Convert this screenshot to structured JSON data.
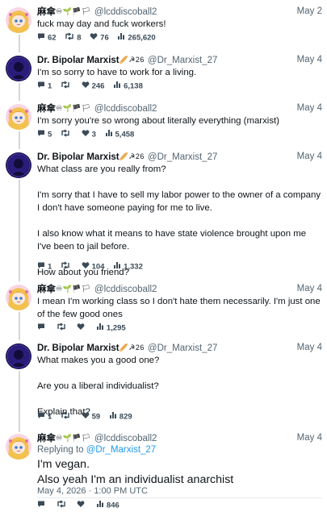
{
  "tweets": [
    {
      "name": "麻傘",
      "name_emoji": "♾🌱🏴🏳",
      "handle": "@lcddiscoball2",
      "date": "May 2",
      "text": [
        "fuck may day and fuck workers!"
      ],
      "replies": "62",
      "retweets": "8",
      "likes": "76",
      "views": "265,620"
    },
    {
      "name": "Dr. Bipolar Marxist",
      "name_emoji": "🥖☭26",
      "handle": "@Dr_Marxist_27",
      "date": "May 4",
      "text": [
        "I'm so sorry to have to work for a living."
      ],
      "replies": "1",
      "retweets": "",
      "likes": "246",
      "views": "6,138"
    },
    {
      "name": "麻傘",
      "name_emoji": "♾🌱🏴🏳",
      "handle": "@lcddiscoball2",
      "date": "May 4",
      "text": [
        "I'm sorry you're so wrong about literally everything (marxist)"
      ],
      "replies": "5",
      "retweets": "",
      "likes": "3",
      "views": "5,458"
    },
    {
      "name": "Dr. Bipolar Marxist",
      "name_emoji": "🥖☭26",
      "handle": "@Dr_Marxist_27",
      "date": "May 4",
      "text": [
        "What class are you really from?",
        "I'm sorry that I have to sell my labor power to the owner of a company I don't have someone paying for me to live.",
        "I also know what it means to have state violence brought upon me I've been to jail before.",
        "How about you friend?"
      ],
      "replies": "1",
      "retweets": "",
      "likes": "104",
      "views": "1,332"
    },
    {
      "name": "麻傘",
      "name_emoji": "♾🌱🏴🏳",
      "handle": "@lcddiscoball2",
      "date": "May 4",
      "text": [
        "I mean I'm working class so I don't hate them necessarily. I'm just one of the few good ones"
      ],
      "replies": "",
      "retweets": "",
      "likes": "",
      "views": "1,295"
    },
    {
      "name": "Dr. Bipolar Marxist",
      "name_emoji": "🥖☭26",
      "handle": "@Dr_Marxist_27",
      "date": "May 4",
      "text": [
        "What makes you a good one?",
        "Are you a liberal individualist?",
        "Explain that?"
      ],
      "replies": "1",
      "retweets": "",
      "likes": "59",
      "views": "829"
    }
  ],
  "main_tweet": {
    "name": "麻傘",
    "name_emoji": "♾🌱🏴🏳",
    "handle": "@lcddiscoball2",
    "date": "May 4",
    "replying_prefix": "Replying to",
    "replying_to": "@Dr_Marxist_27",
    "lines": [
      "I'm vegan.",
      "Also yeah I'm an individualist anarchist"
    ],
    "timestamp": "May 4, 2026 · 1:00 PM UTC",
    "replies": "",
    "retweets": "",
    "likes": "",
    "views": "846"
  },
  "colors": {
    "muted": "#536471",
    "link": "#1d9bf0",
    "thread_line": "#cfd9de"
  }
}
